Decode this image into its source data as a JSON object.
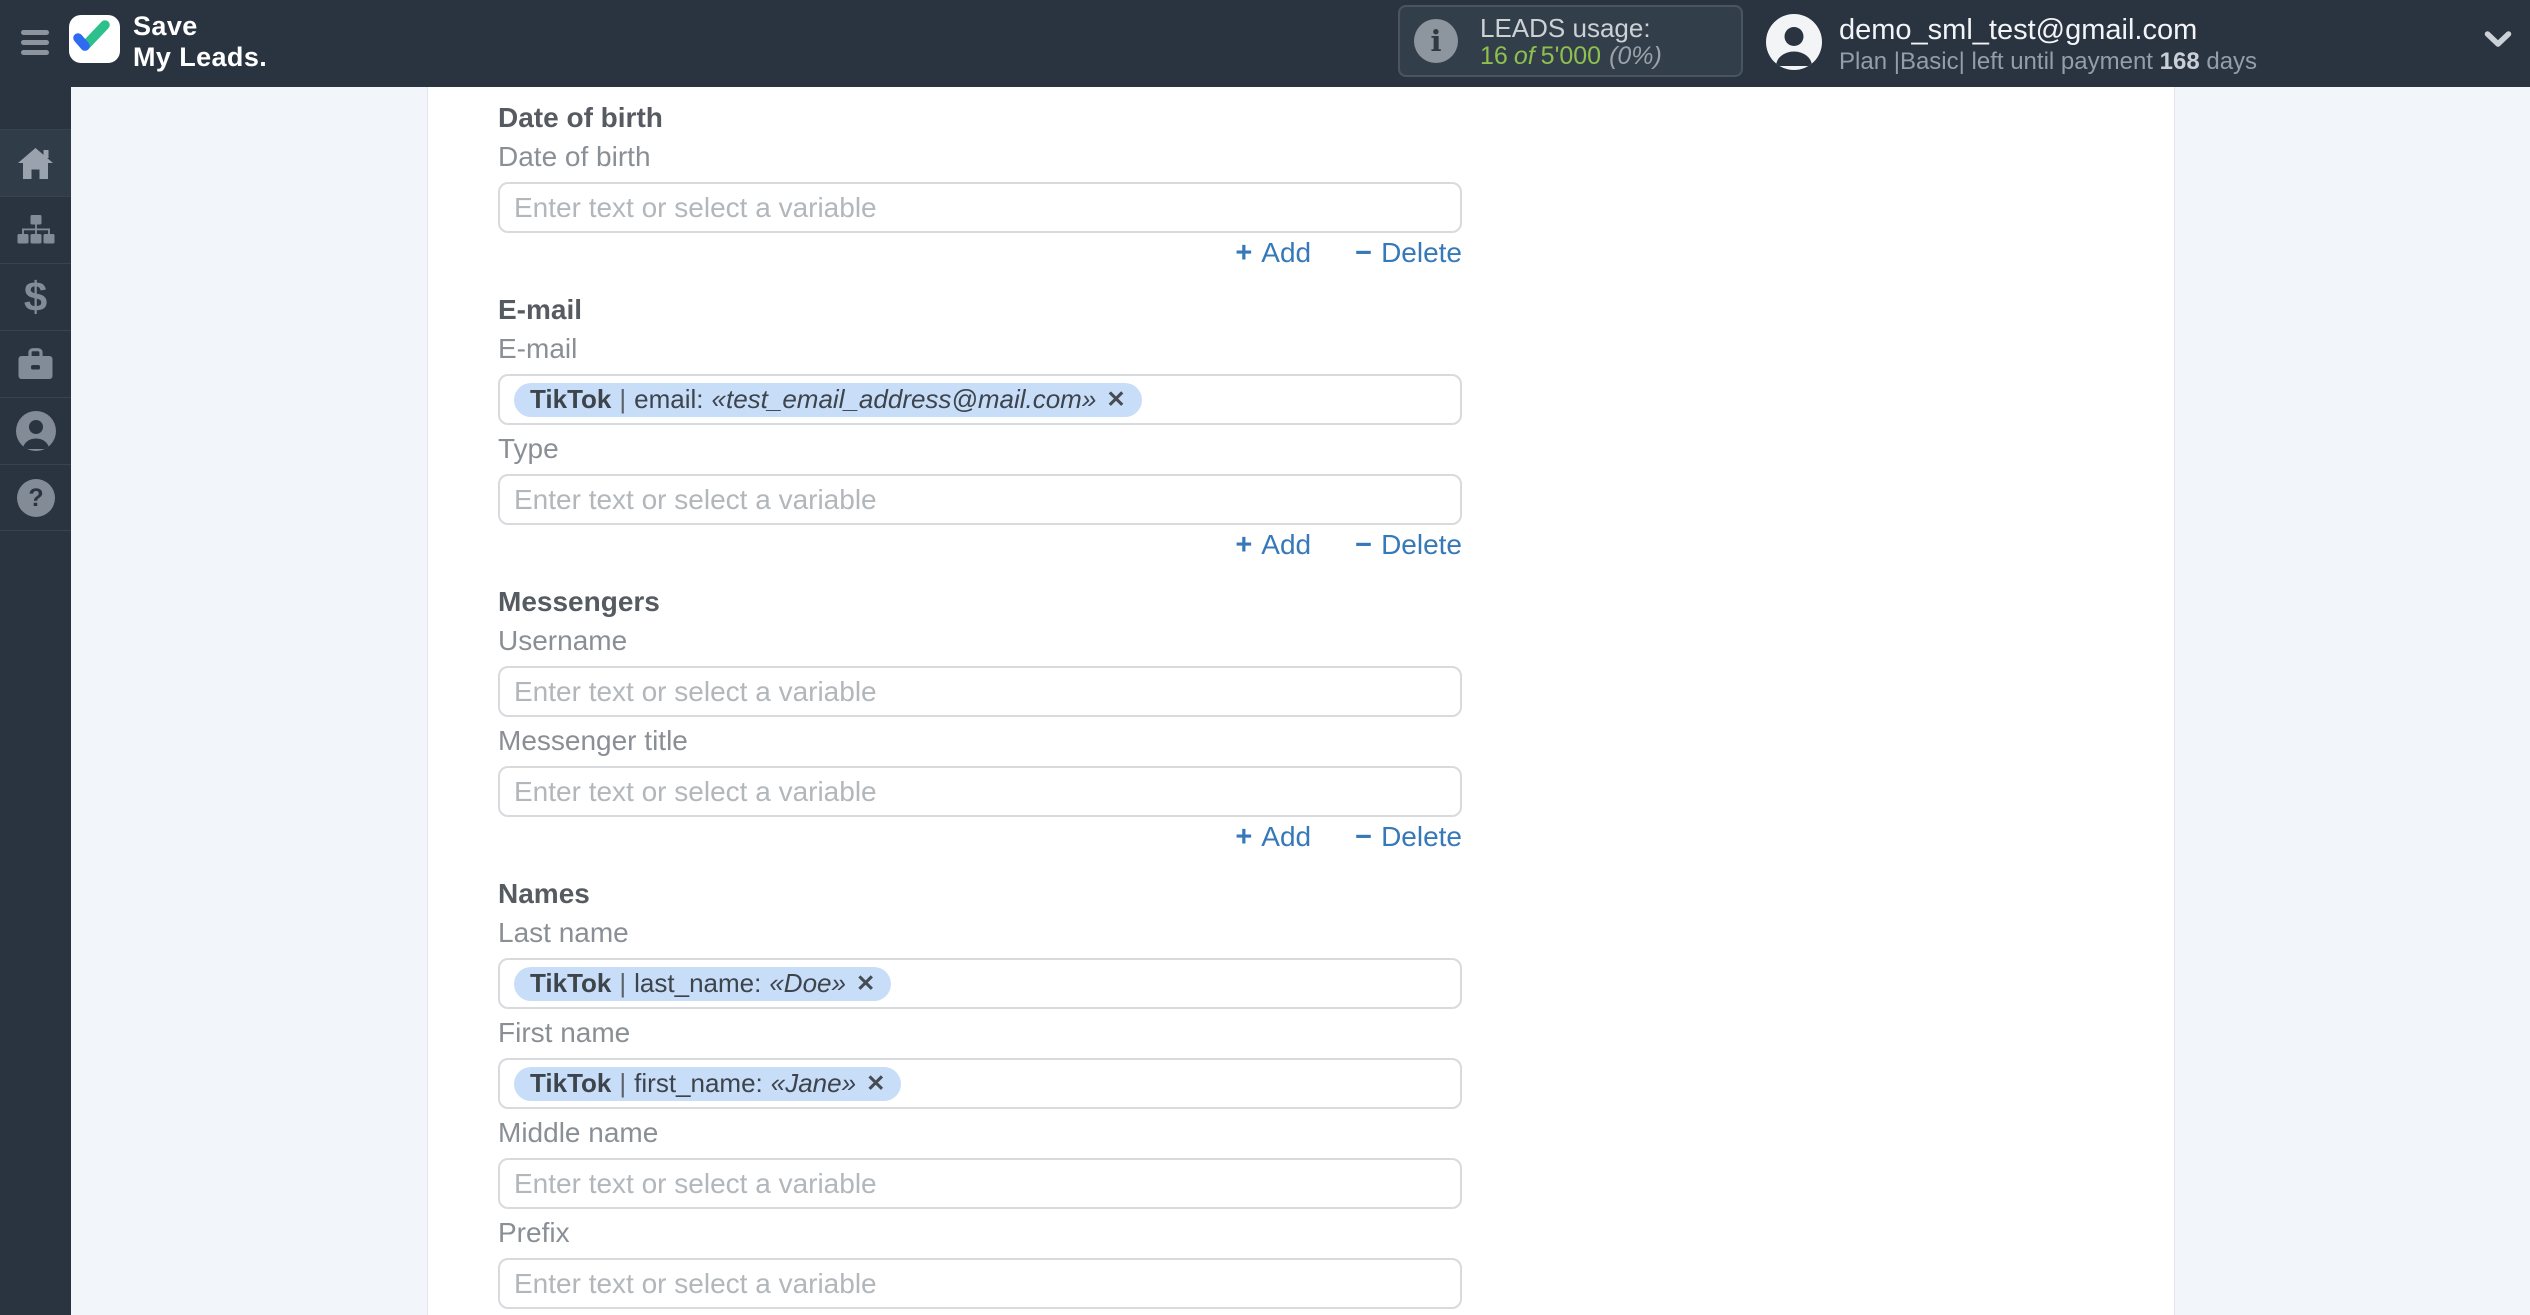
{
  "header": {
    "brand": {
      "line1": "Save",
      "line2": "My Leads."
    },
    "usage": {
      "title": "LEADS usage:",
      "used": "16",
      "of_word": "of",
      "total": "5'000",
      "percent": "(0%)"
    },
    "account": {
      "email": "demo_sml_test@gmail.com",
      "plan_prefix": "Plan |Basic| left until payment",
      "days_value": "168",
      "days_suffix": "days"
    }
  },
  "sidebar": {
    "items": [
      {
        "icon": "home-icon"
      },
      {
        "icon": "sitemap-icon"
      },
      {
        "icon": "dollar-icon"
      },
      {
        "icon": "briefcase-icon"
      },
      {
        "icon": "user-icon"
      },
      {
        "icon": "help-icon"
      }
    ]
  },
  "form": {
    "placeholder": "Enter text or select a variable",
    "add_label": "Add",
    "add_glyph": "+",
    "delete_label": "Delete",
    "delete_glyph": "−",
    "tag_separator": "|",
    "tag_remove_glyph": "✕",
    "sections": [
      {
        "heading": "Date of birth",
        "actions": true,
        "fields": [
          {
            "label": "Date of birth",
            "kind": "empty"
          }
        ]
      },
      {
        "heading": "E-mail",
        "actions": true,
        "fields": [
          {
            "label": "E-mail",
            "kind": "tag",
            "tag": {
              "source": "TikTok",
              "field": "email:",
              "value": "«test_email_address@mail.com»"
            }
          },
          {
            "label": "Type",
            "kind": "empty"
          }
        ]
      },
      {
        "heading": "Messengers",
        "actions": true,
        "fields": [
          {
            "label": "Username",
            "kind": "empty"
          },
          {
            "label": "Messenger title",
            "kind": "empty"
          }
        ]
      },
      {
        "heading": "Names",
        "actions": false,
        "fields": [
          {
            "label": "Last name",
            "kind": "tag",
            "tag": {
              "source": "TikTok",
              "field": "last_name:",
              "value": "«Doe»"
            }
          },
          {
            "label": "First name",
            "kind": "tag",
            "tag": {
              "source": "TikTok",
              "field": "first_name:",
              "value": "«Jane»"
            }
          },
          {
            "label": "Middle name",
            "kind": "empty"
          },
          {
            "label": "Prefix",
            "kind": "empty"
          }
        ]
      }
    ]
  },
  "colors": {
    "header_bg": "#2a3441",
    "page_bg": "#f2f5fa",
    "accent_green": "#8ec04e",
    "link_blue": "#3779b8",
    "tag_bg": "#c8ddf8",
    "logo_blue": "#2f6bf0",
    "logo_green": "#2cc08d"
  }
}
